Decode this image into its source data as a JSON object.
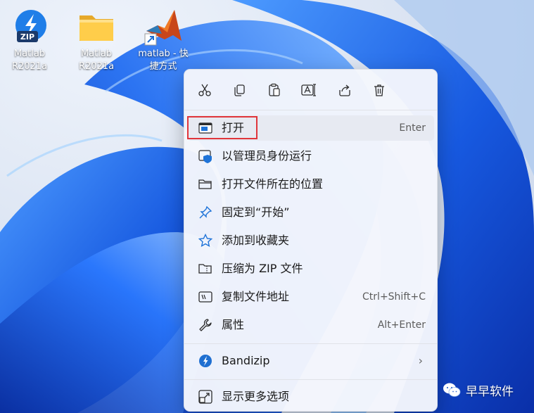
{
  "colors": {
    "accent": "#0067c0",
    "highlight_box": "#e0353b",
    "wallpaper": "#2a6fe8"
  },
  "desktop": {
    "icons": [
      {
        "label_line1": "Matlab",
        "label_line2": "R2021a",
        "icon": "bandizip-zip-icon"
      },
      {
        "label_line1": "Matlab",
        "label_line2": "R2021a",
        "icon": "folder-icon"
      },
      {
        "label_line1": "matlab - 快",
        "label_line2": "捷方式",
        "icon": "matlab-shortcut-icon"
      }
    ]
  },
  "context_menu": {
    "toolbar": [
      {
        "icon": "cut-icon"
      },
      {
        "icon": "copy-icon"
      },
      {
        "icon": "paste-icon"
      },
      {
        "icon": "rename-icon"
      },
      {
        "icon": "share-icon"
      },
      {
        "icon": "delete-icon"
      }
    ],
    "items": [
      {
        "label": "打开",
        "shortcut": "Enter",
        "icon": "open-app-icon"
      },
      {
        "label": "以管理员身份运行",
        "shortcut": "",
        "icon": "admin-shield-icon"
      },
      {
        "label": "打开文件所在的位置",
        "shortcut": "",
        "icon": "folder-open-icon"
      },
      {
        "label": "固定到“开始”",
        "shortcut": "",
        "icon": "pin-icon"
      },
      {
        "label": "添加到收藏夹",
        "shortcut": "",
        "icon": "star-icon"
      },
      {
        "label": "压缩为 ZIP 文件",
        "shortcut": "",
        "icon": "zip-folder-icon"
      },
      {
        "label": "复制文件地址",
        "shortcut": "Ctrl+Shift+C",
        "icon": "copy-path-icon"
      },
      {
        "label": "属性",
        "shortcut": "Alt+Enter",
        "icon": "wrench-icon"
      },
      {
        "label": "Bandizip",
        "shortcut": "",
        "icon": "bandizip-icon"
      },
      {
        "label": "显示更多选项",
        "shortcut": "",
        "icon": "more-options-icon"
      }
    ]
  },
  "watermark": {
    "text": "早早软件",
    "icon": "wechat-icon"
  }
}
